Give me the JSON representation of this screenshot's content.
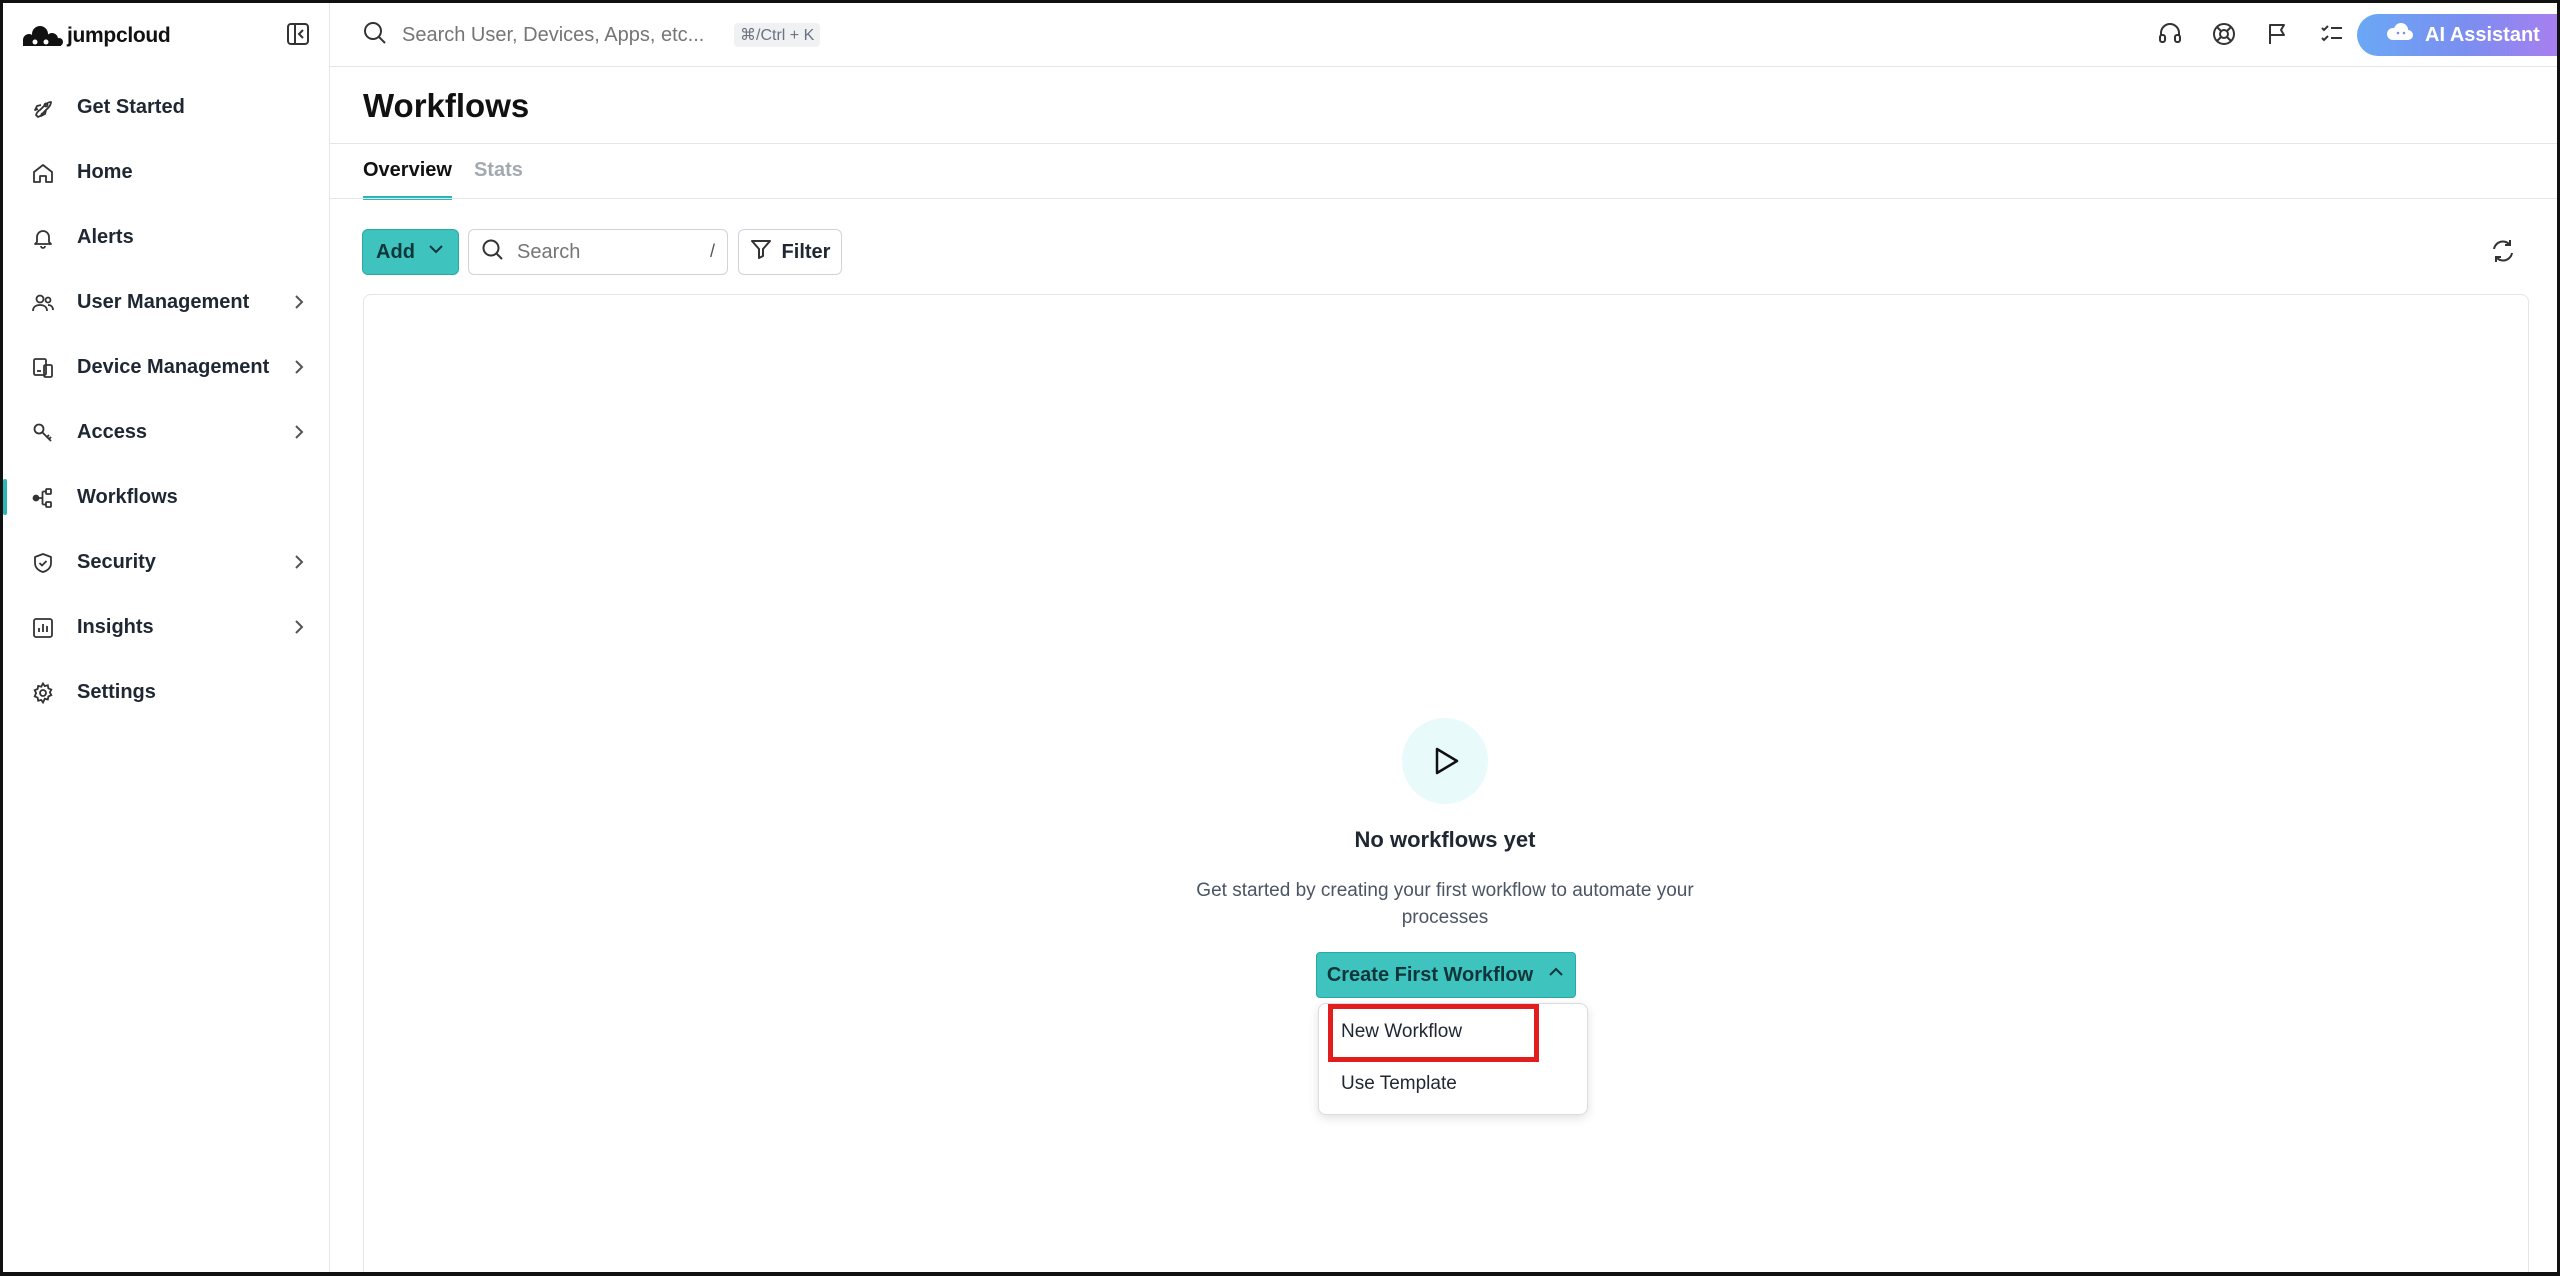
{
  "brand": {
    "name": "jumpcloud"
  },
  "sidebar": {
    "items": [
      {
        "label": "Get Started",
        "icon": "rocket-icon",
        "has_chevron": false,
        "active": false
      },
      {
        "label": "Home",
        "icon": "home-icon",
        "has_chevron": false,
        "active": false
      },
      {
        "label": "Alerts",
        "icon": "bell-icon",
        "has_chevron": false,
        "active": false
      },
      {
        "label": "User Management",
        "icon": "users-icon",
        "has_chevron": true,
        "active": false
      },
      {
        "label": "Device Management",
        "icon": "devices-icon",
        "has_chevron": true,
        "active": false
      },
      {
        "label": "Access",
        "icon": "key-icon",
        "has_chevron": true,
        "active": false
      },
      {
        "label": "Workflows",
        "icon": "workflow-icon",
        "has_chevron": false,
        "active": true
      },
      {
        "label": "Security",
        "icon": "shield-icon",
        "has_chevron": true,
        "active": false
      },
      {
        "label": "Insights",
        "icon": "chart-icon",
        "has_chevron": true,
        "active": false
      },
      {
        "label": "Settings",
        "icon": "gear-icon",
        "has_chevron": false,
        "active": false
      }
    ]
  },
  "topbar": {
    "search_placeholder": "Search User, Devices, Apps, etc...",
    "shortcut": "⌘/Ctrl + K",
    "icons": [
      "headset-icon",
      "lifebuoy-icon",
      "flag-icon",
      "checklist-icon"
    ],
    "ai_assistant_label": "AI Assistant"
  },
  "page": {
    "title": "Workflows",
    "tabs": [
      {
        "label": "Overview",
        "active": true
      },
      {
        "label": "Stats",
        "active": false
      }
    ]
  },
  "toolbar": {
    "add_label": "Add",
    "search_placeholder": "Search",
    "search_shortcut": "/",
    "filter_label": "Filter"
  },
  "empty_state": {
    "title": "No workflows yet",
    "description": "Get started by creating your first workflow to automate your processes",
    "create_label": "Create First Workflow",
    "menu_items": [
      "New Workflow",
      "Use Template"
    ]
  },
  "colors": {
    "accent": "#3ec3bf",
    "highlight": "#e11d1d"
  }
}
